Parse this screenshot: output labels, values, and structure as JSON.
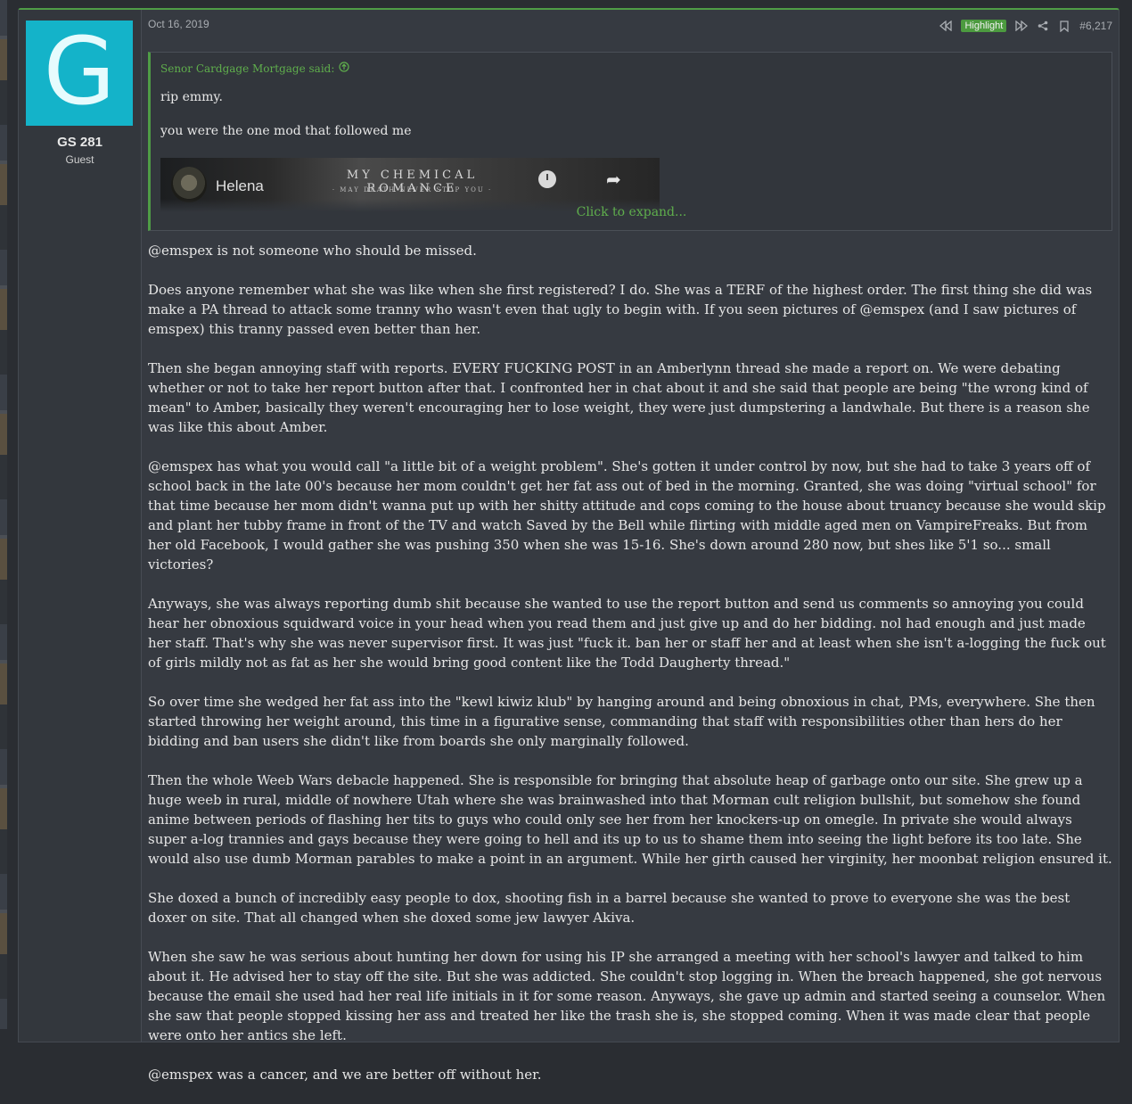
{
  "post": {
    "date": "Oct 16, 2019",
    "highlight_label": "Highlight",
    "number": "#6,217"
  },
  "user": {
    "avatar_letter": "G",
    "name": "GS 281",
    "title": "Guest"
  },
  "quote": {
    "author": "Senor Cardgage Mortgage said:",
    "line1": "rip emmy.",
    "line2": "you were the one mod that followed me",
    "embed_title": "Helena",
    "embed_band": "MY CHEMICAL ROMANCE",
    "embed_sub": "· MAY DEATH NEVER STOP YOU ·",
    "expand": "Click to expand..."
  },
  "body": [
    "@emspex is not someone who should be missed.",
    "Does anyone remember what she was like when she first registered? I do. She was a TERF of the highest order. The first thing she did was make a PA thread to attack some tranny who wasn't even that ugly to begin with. If you seen pictures of @emspex (and I saw pictures of emspex) this tranny passed even better than her.",
    "Then she began annoying staff with reports. EVERY FUCKING POST in an Amberlynn thread she made a report on. We were debating whether or not to take her report button after that. I confronted her in chat about it and she said that people are being \"the wrong kind of mean\" to Amber, basically they weren't encouraging her to lose weight, they were just dumpstering a landwhale. But there is a reason she was like this about Amber.",
    "@emspex has what you would call \"a little bit of a weight problem\". She's gotten it under control by now, but she had to take 3 years off of school back in the late 00's because her mom couldn't get her fat ass out of bed in the morning. Granted, she was doing \"virtual school\" for that time because her mom didn't wanna put up with her shitty attitude and cops coming to the house about truancy because she would skip and plant her tubby frame in front of the TV and watch Saved by the Bell while flirting with middle aged men on VampireFreaks. But from her old Facebook, I would gather she was pushing 350 when she was 15-16. She's down around 280 now, but shes like 5'1 so... small victories?",
    "Anyways, she was always reporting dumb shit because she wanted to use the report button and send us comments so annoying you could hear her obnoxious squidward voice in your head when you read them and just give up and do her bidding. nol had enough and just made her staff. That's why she was never supervisor first. It was just \"fuck it. ban her or staff her and at least when she isn't a-logging the fuck out of girls mildly not as fat as her she would bring good content like the Todd Daugherty thread.\"",
    "So over time she wedged her fat ass into the \"kewl kiwiz klub\" by hanging around and being obnoxious in chat, PMs, everywhere. She then started throwing her weight around, this time in a figurative sense, commanding that staff with responsibilities other than hers do her bidding and ban users she didn't like from boards she only marginally followed.",
    "Then the whole Weeb Wars debacle happened. She is responsible for bringing that absolute heap of garbage onto our site. She grew up a huge weeb in rural, middle of nowhere Utah where she was brainwashed into that Morman cult religion bullshit, but somehow she found anime between periods of flashing her tits to guys who could only see her from her knockers-up on omegle. In private she would always super a-log trannies and gays because they were going to hell and its up to us to shame them into seeing the light before its too late. She would also use dumb Morman parables to make a point in an argument. While her girth caused her virginity, her moonbat religion ensured it.",
    "She doxed a bunch of incredibly easy people to dox, shooting fish in a barrel because she wanted to prove to everyone she was the best doxer on site. That all changed when she doxed some jew lawyer Akiva.",
    "When she saw he was serious about hunting her down for using his IP she arranged a meeting with her school's lawyer and talked to him about it. He advised her to stay off the site. But she was addicted. She couldn't stop logging in. When the breach happened, she got nervous because the email she used had her real life initials in it for some reason. Anyways, she gave up admin and started seeing a counselor. When she saw that people stopped kissing her ass and treated her like the trash she is, she stopped coming. When it was made clear that people were onto her antics she left.",
    "@emspex was a cancer, and we are better off without her."
  ],
  "colors": {
    "accent": "#4f9c46",
    "avatar": "#14b3c9"
  },
  "icons": [
    "rewind-icon",
    "fast-forward-icon",
    "share-icon",
    "bookmark-icon",
    "arrow-up-circle-icon",
    "clock-icon"
  ]
}
